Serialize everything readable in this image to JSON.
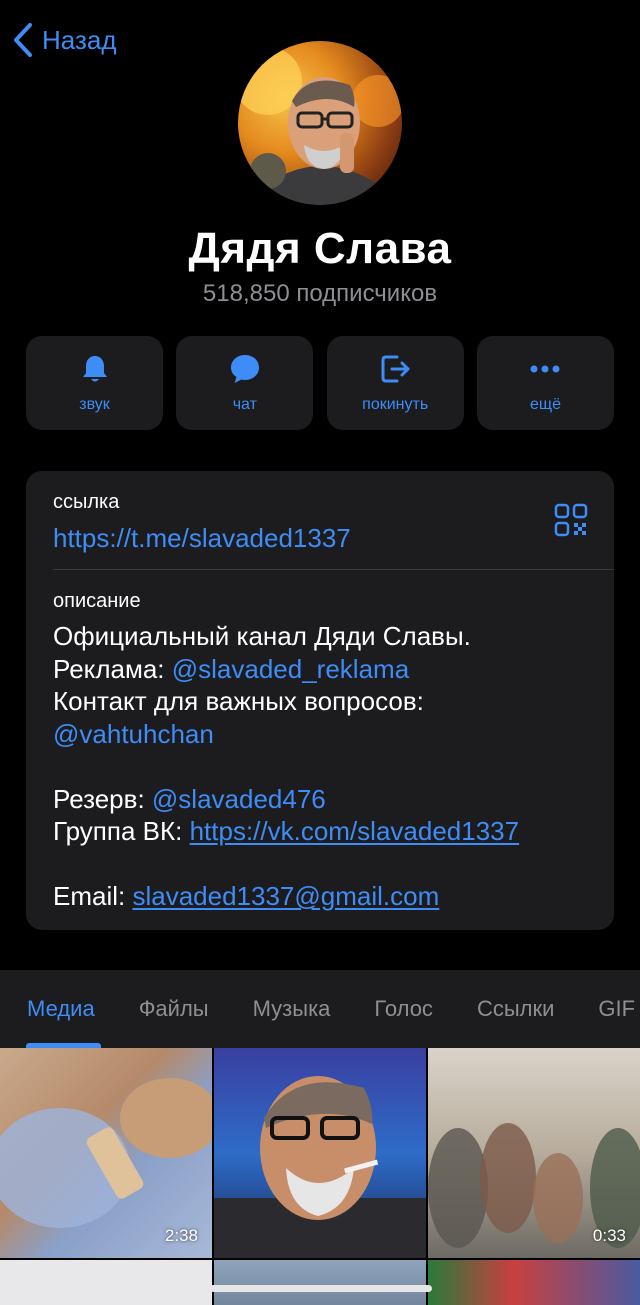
{
  "nav": {
    "back_label": "Назад"
  },
  "channel": {
    "name": "Дядя Слава",
    "subscribers": "518,850 подписчиков"
  },
  "actions": [
    {
      "label": "звук",
      "icon": "bell-icon"
    },
    {
      "label": "чат",
      "icon": "chat-bubble-icon"
    },
    {
      "label": "покинуть",
      "icon": "leave-icon"
    },
    {
      "label": "ещё",
      "icon": "more-dots-icon"
    }
  ],
  "info": {
    "link_label": "ссылка",
    "link_value": "https://t.me/slavaded1337",
    "description_label": "описание",
    "description": {
      "line1": "Официальный канал Дяди Славы.",
      "ads_prefix": "Реклама: ",
      "ads_handle": "@slavaded_reklama",
      "contact_text": "Контакт для важных вопросов:",
      "contact_handle": "@vahtuhchan",
      "reserve_prefix": "Резерв: ",
      "reserve_handle": "@slavaded476",
      "vk_prefix": "Группа ВК: ",
      "vk_link": "https://vk.com/slavaded1337",
      "email_prefix": "Email: ",
      "email_link": "slavaded1337@gmail.com"
    }
  },
  "tabs": [
    "Медиа",
    "Файлы",
    "Музыка",
    "Голос",
    "Ссылки",
    "GIF"
  ],
  "media": [
    {
      "duration": "2:38"
    },
    {
      "duration": ""
    },
    {
      "duration": "0:33"
    }
  ],
  "colors": {
    "accent": "#3e8cf5",
    "background": "#000000",
    "card": "#1c1c1e",
    "secondary_text": "#8e8e93"
  }
}
